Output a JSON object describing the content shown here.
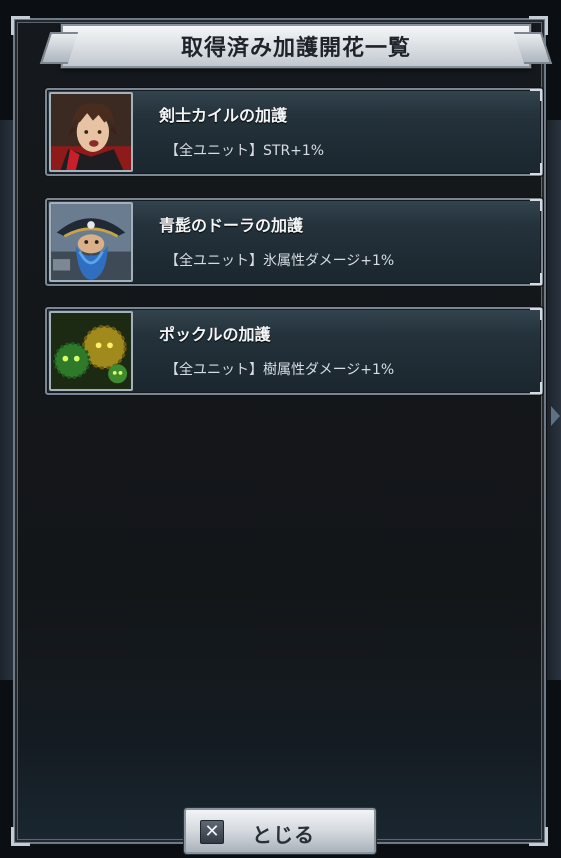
{
  "dialog": {
    "title": "取得済み加護開花一覧"
  },
  "blessings": [
    {
      "name": "剣士カイルの加護",
      "effect": "【全ユニット】STR+1%",
      "portrait_icon": "swordsman-kyle-portrait"
    },
    {
      "name": "青髭のドーラの加護",
      "effect": "【全ユニット】氷属性ダメージ+1%",
      "portrait_icon": "bluebeard-dora-portrait"
    },
    {
      "name": "ポックルの加護",
      "effect": "【全ユニット】樹属性ダメージ+1%",
      "portrait_icon": "pokkuru-portrait"
    }
  ],
  "close_button": {
    "label": "とじる",
    "icon": "close-icon"
  }
}
